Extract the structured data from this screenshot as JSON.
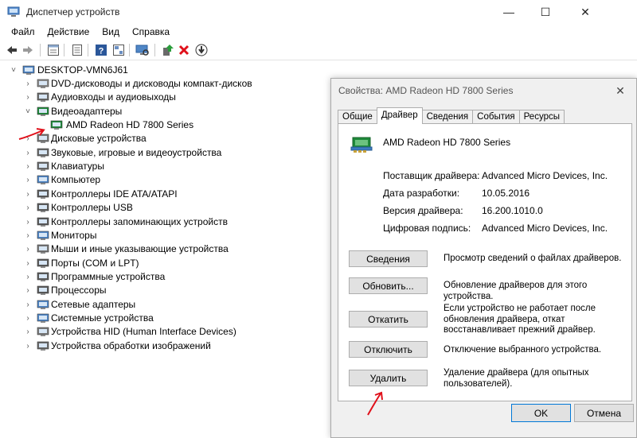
{
  "window": {
    "title": "Диспетчер устройств",
    "controls": {
      "minimize": "—",
      "maximize": "☐",
      "close": "✕"
    }
  },
  "menu": [
    "Файл",
    "Действие",
    "Вид",
    "Справка"
  ],
  "toolbar_icons": [
    "back-icon",
    "forward-icon",
    "properties-icon",
    "show-hidden-icon",
    "help-icon",
    "action-icon",
    "scan-hardware-icon",
    "update-driver-icon",
    "uninstall-icon",
    "download-icon"
  ],
  "tree": {
    "root": "DESKTOP-VMN6J61",
    "items": [
      {
        "label": "DVD-дисководы и дисководы компакт-дисков",
        "icon": "dvd-drive-icon",
        "expanded": false
      },
      {
        "label": "Аудиовходы и аудиовыходы",
        "icon": "audio-icon",
        "expanded": false
      },
      {
        "label": "Видеоадаптеры",
        "icon": "display-adapter-icon",
        "expanded": true
      },
      {
        "label": "AMD Radeon HD 7800 Series",
        "icon": "display-adapter-icon",
        "child": true
      },
      {
        "label": "Дисковые устройства",
        "icon": "disk-drive-icon",
        "expanded": false
      },
      {
        "label": "Звуковые, игровые и видеоустройства",
        "icon": "sound-icon",
        "expanded": false
      },
      {
        "label": "Клавиатуры",
        "icon": "keyboard-icon",
        "expanded": false
      },
      {
        "label": "Компьютер",
        "icon": "computer-icon",
        "expanded": false
      },
      {
        "label": "Контроллеры IDE ATA/ATAPI",
        "icon": "ide-controller-icon",
        "expanded": false
      },
      {
        "label": "Контроллеры USB",
        "icon": "usb-icon",
        "expanded": false
      },
      {
        "label": "Контроллеры запоминающих устройств",
        "icon": "storage-controller-icon",
        "expanded": false
      },
      {
        "label": "Мониторы",
        "icon": "monitor-icon",
        "expanded": false
      },
      {
        "label": "Мыши и иные указывающие устройства",
        "icon": "mouse-icon",
        "expanded": false
      },
      {
        "label": "Порты (COM и LPT)",
        "icon": "port-icon",
        "expanded": false
      },
      {
        "label": "Программные устройства",
        "icon": "software-device-icon",
        "expanded": false
      },
      {
        "label": "Процессоры",
        "icon": "processor-icon",
        "expanded": false
      },
      {
        "label": "Сетевые адаптеры",
        "icon": "network-adapter-icon",
        "expanded": false
      },
      {
        "label": "Системные устройства",
        "icon": "system-device-icon",
        "expanded": false
      },
      {
        "label": "Устройства HID (Human Interface Devices)",
        "icon": "hid-icon",
        "expanded": false
      },
      {
        "label": "Устройства обработки изображений",
        "icon": "imaging-device-icon",
        "expanded": false
      }
    ]
  },
  "dialog": {
    "title": "Свойства: AMD Radeon HD 7800 Series",
    "close": "✕",
    "tabs": [
      "Общие",
      "Драйвер",
      "Сведения",
      "События",
      "Ресурсы"
    ],
    "active_tab": "Драйвер",
    "device_name": "AMD Radeon HD 7800 Series",
    "properties": [
      {
        "label": "Поставщик драйвера:",
        "value": "Advanced Micro Devices, Inc."
      },
      {
        "label": "Дата разработки:",
        "value": "10.05.2016"
      },
      {
        "label": "Версия драйвера:",
        "value": "16.200.1010.0"
      },
      {
        "label": "Цифровая подпись:",
        "value": "Advanced Micro Devices, Inc."
      }
    ],
    "buttons": [
      {
        "label": "Сведения",
        "desc": "Просмотр сведений о файлах драйверов."
      },
      {
        "label": "Обновить...",
        "desc": "Обновление драйверов для этого устройства."
      },
      {
        "label": "Откатить",
        "desc": "Если устройство не работает после обновления драйвера, откат восстанавливает прежний драйвер."
      },
      {
        "label": "Отключить",
        "desc": "Отключение выбранного устройства."
      },
      {
        "label": "Удалить",
        "desc": "Удаление драйвера (для опытных пользователей)."
      }
    ],
    "ok": "OK",
    "cancel": "Отмена"
  },
  "colors": {
    "annotation_red": "#e0101a",
    "accent_blue": "#0078d7"
  }
}
